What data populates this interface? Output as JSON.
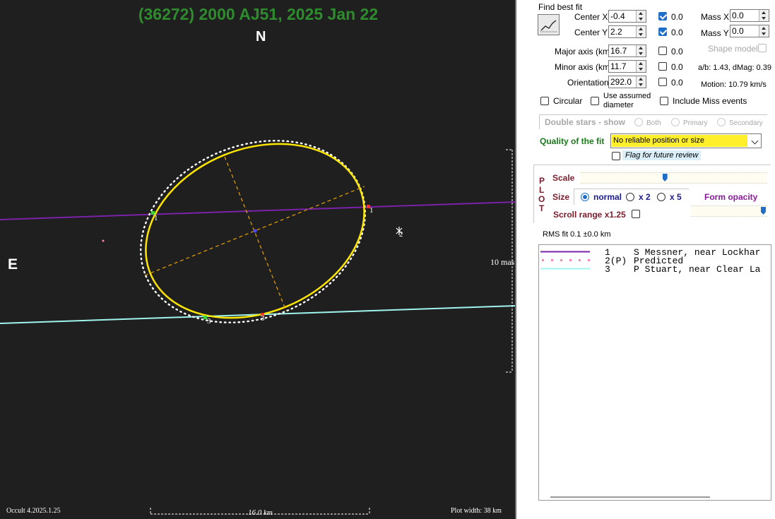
{
  "plot": {
    "title": "(36272) 2000 AJ51,   2025 Jan 22",
    "north": "N",
    "east": "E",
    "scale_label": "10 mas",
    "width_label": "16.0 km",
    "version": "Occult 4.2025.1.25",
    "plot_width": "Plot width: 38 km",
    "chord_labels": [
      "1",
      "1",
      "2",
      "3",
      "3"
    ],
    "colors": {
      "background": "#1f1f1f",
      "ellipse": "#ffe600",
      "chord1": "#7a22a8",
      "chord2": "#ff7fbf",
      "chord3": "#9ff5ee",
      "axes": "#e8a200",
      "title": "#2e8b2e"
    }
  },
  "panel": {
    "find_best_fit": "Find best fit",
    "center_x": {
      "label": "Center X",
      "value": "-0.4",
      "checked": true,
      "extra": "0.0"
    },
    "center_y": {
      "label": "Center Y",
      "value": "2.2",
      "checked": true,
      "extra": "0.0"
    },
    "mass_x": {
      "label": "Mass X",
      "value": "0.0"
    },
    "mass_y": {
      "label": "Mass Y",
      "value": "0.0"
    },
    "major_axis": {
      "label": "Major axis (km)",
      "value": "16.7",
      "checked": false,
      "extra": "0.0"
    },
    "minor_axis": {
      "label": "Minor axis (km)",
      "value": "11.7",
      "checked": false,
      "extra": "0.0"
    },
    "orientation": {
      "label": "Orientation",
      "value": "292.0",
      "checked": false,
      "extra": "0.0"
    },
    "shape_model": "Shape model",
    "ab_info": "a/b: 1.43, dMag: 0.39",
    "motion": "Motion: 10.79 km/s",
    "circular": "Circular",
    "use_assumed": "Use assumed",
    "diameter": "diameter",
    "include_miss": "Include Miss events",
    "double_stars": "Double stars - show",
    "both": "Both",
    "primary": "Primary",
    "secondary": "Secondary",
    "quality_label": "Quality of the fit",
    "quality_value": "No reliable position or size",
    "flag_review": "Flag for future review",
    "plot_letters": [
      "P",
      "L",
      "O",
      "T"
    ],
    "scale": "Scale",
    "size": "Size",
    "size_normal": "normal",
    "size_x2": "x 2",
    "size_x5": "x 5",
    "form_opacity": "Form opacity",
    "scroll_range": "Scroll range x1.25",
    "rms_fit": "RMS fit 0.1 ±0.0 km",
    "scale_level": 0.45,
    "opacity_level": 0.98
  },
  "legend": {
    "rows": [
      {
        "num": "1",
        "text": "S Messner, near Lockhar",
        "color": "#7a22a8",
        "style": "solid"
      },
      {
        "num": "2(P)",
        "text": "Predicted",
        "color": "#ff7fbf",
        "style": "dotted"
      },
      {
        "num": "3",
        "text": "P Stuart, near Clear La",
        "color": "#9ff5ee",
        "style": "solid"
      }
    ]
  }
}
